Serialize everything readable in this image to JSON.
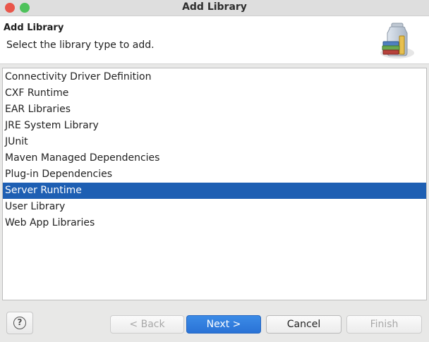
{
  "window": {
    "title": "Add Library"
  },
  "header": {
    "title": "Add Library",
    "description": "Select the library type to add."
  },
  "library_types": [
    "Connectivity Driver Definition",
    "CXF Runtime",
    "EAR Libraries",
    "JRE System Library",
    "JUnit",
    "Maven Managed Dependencies",
    "Plug-in Dependencies",
    "Server Runtime",
    "User Library",
    "Web App Libraries"
  ],
  "selected_library": "Server Runtime",
  "buttons": {
    "help": "?",
    "back": "< Back",
    "next": "Next >",
    "cancel": "Cancel",
    "finish": "Finish"
  },
  "icons": {
    "help": "help-icon",
    "header": "library-jar-books-icon"
  },
  "colors": {
    "selection": "#1e5fb3",
    "primary_button": "#2a73d6",
    "close": "#e9564a",
    "maximize": "#4ec25b"
  }
}
